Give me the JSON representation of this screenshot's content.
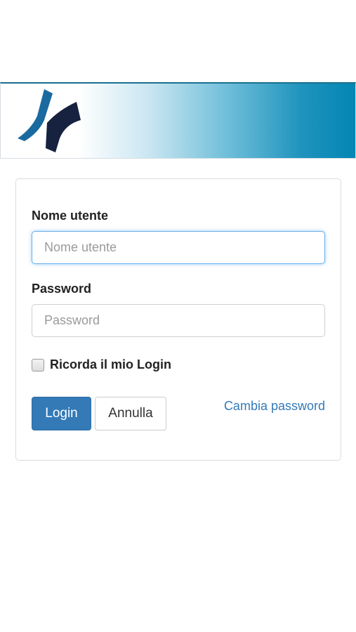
{
  "login_form": {
    "username_label": "Nome utente",
    "username_placeholder": "Nome utente",
    "username_value": "",
    "password_label": "Password",
    "password_placeholder": "Password",
    "password_value": "",
    "remember_label": "Ricorda il mio Login",
    "remember_checked": false,
    "login_button": "Login",
    "cancel_button": "Annulla",
    "change_password_link": "Cambia password"
  },
  "colors": {
    "primary": "#337ab7",
    "banner_dark": "#0486b3",
    "logo_blue": "#1a6aa0",
    "logo_navy": "#16223f"
  },
  "icons": {
    "logo": "brand-logo-icon",
    "checkbox": "checkbox-unchecked"
  }
}
